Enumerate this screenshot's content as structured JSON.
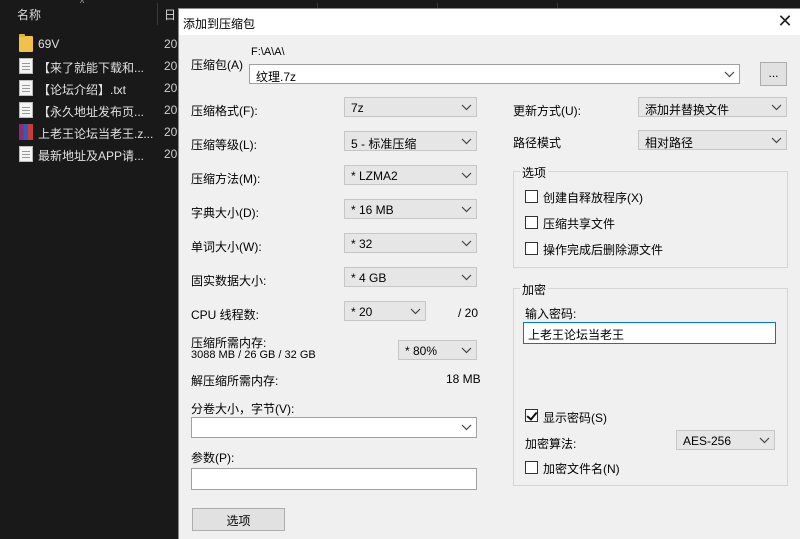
{
  "explorer": {
    "col_name": "名称",
    "col_date": "日",
    "files": [
      {
        "name": "69V",
        "date": "20",
        "icon": "folder-icon"
      },
      {
        "name": "【来了就能下载和...",
        "date": "20",
        "icon": "text-file-icon"
      },
      {
        "name": "【论坛介绍】.txt",
        "date": "20",
        "icon": "text-file-icon"
      },
      {
        "name": "【永久地址发布页...",
        "date": "20",
        "icon": "text-file-icon"
      },
      {
        "name": "上老王论坛当老王.z...",
        "date": "20",
        "icon": "archive-icon"
      },
      {
        "name": "最新地址及APP请...",
        "date": "20",
        "icon": "text-file-icon"
      }
    ]
  },
  "dialog": {
    "title": "添加到压缩包",
    "close": "✕",
    "archive_label": "压缩包(A)",
    "archive_path": "F:\\A\\A\\",
    "archive_name": "纹理.7z",
    "browse": "...",
    "format_label": "压缩格式(F):",
    "format_value": "7z",
    "level_label": "压缩等级(L):",
    "level_value": "5 - 标准压缩",
    "method_label": "压缩方法(M):",
    "method_value": "*  LZMA2",
    "dict_label": "字典大小(D):",
    "dict_value": "*  16 MB",
    "word_label": "单词大小(W):",
    "word_value": "*  32",
    "solid_label": "固实数据大小:",
    "solid_value": "*  4 GB",
    "threads_label": "CPU 线程数:",
    "threads_value": "*  20",
    "threads_total": "/ 20",
    "mem_label": "压缩所需内存:",
    "mem_detail": "3088 MB / 26 GB / 32 GB",
    "mem_value": "* 80%",
    "decomp_label": "解压缩所需内存:",
    "decomp_value": "18 MB",
    "volume_label": "分卷大小，字节(V):",
    "volume_value": "",
    "params_label": "参数(P):",
    "params_value": "",
    "options_button": "选项",
    "update_label": "更新方式(U):",
    "update_value": "添加并替换文件",
    "path_label": "路径模式",
    "path_value": "相对路径",
    "options_group": "选项",
    "opt_sfx": "创建自释放程序(X)",
    "opt_shared": "压缩共享文件",
    "opt_delete": "操作完成后删除源文件",
    "enc_group": "加密",
    "enc_password_label": "输入密码:",
    "enc_password_value": "上老王论坛当老王",
    "show_password": "显示密码(S)",
    "enc_method_label": "加密算法:",
    "enc_method_value": "AES-256",
    "enc_filenames": "加密文件名(N)"
  }
}
